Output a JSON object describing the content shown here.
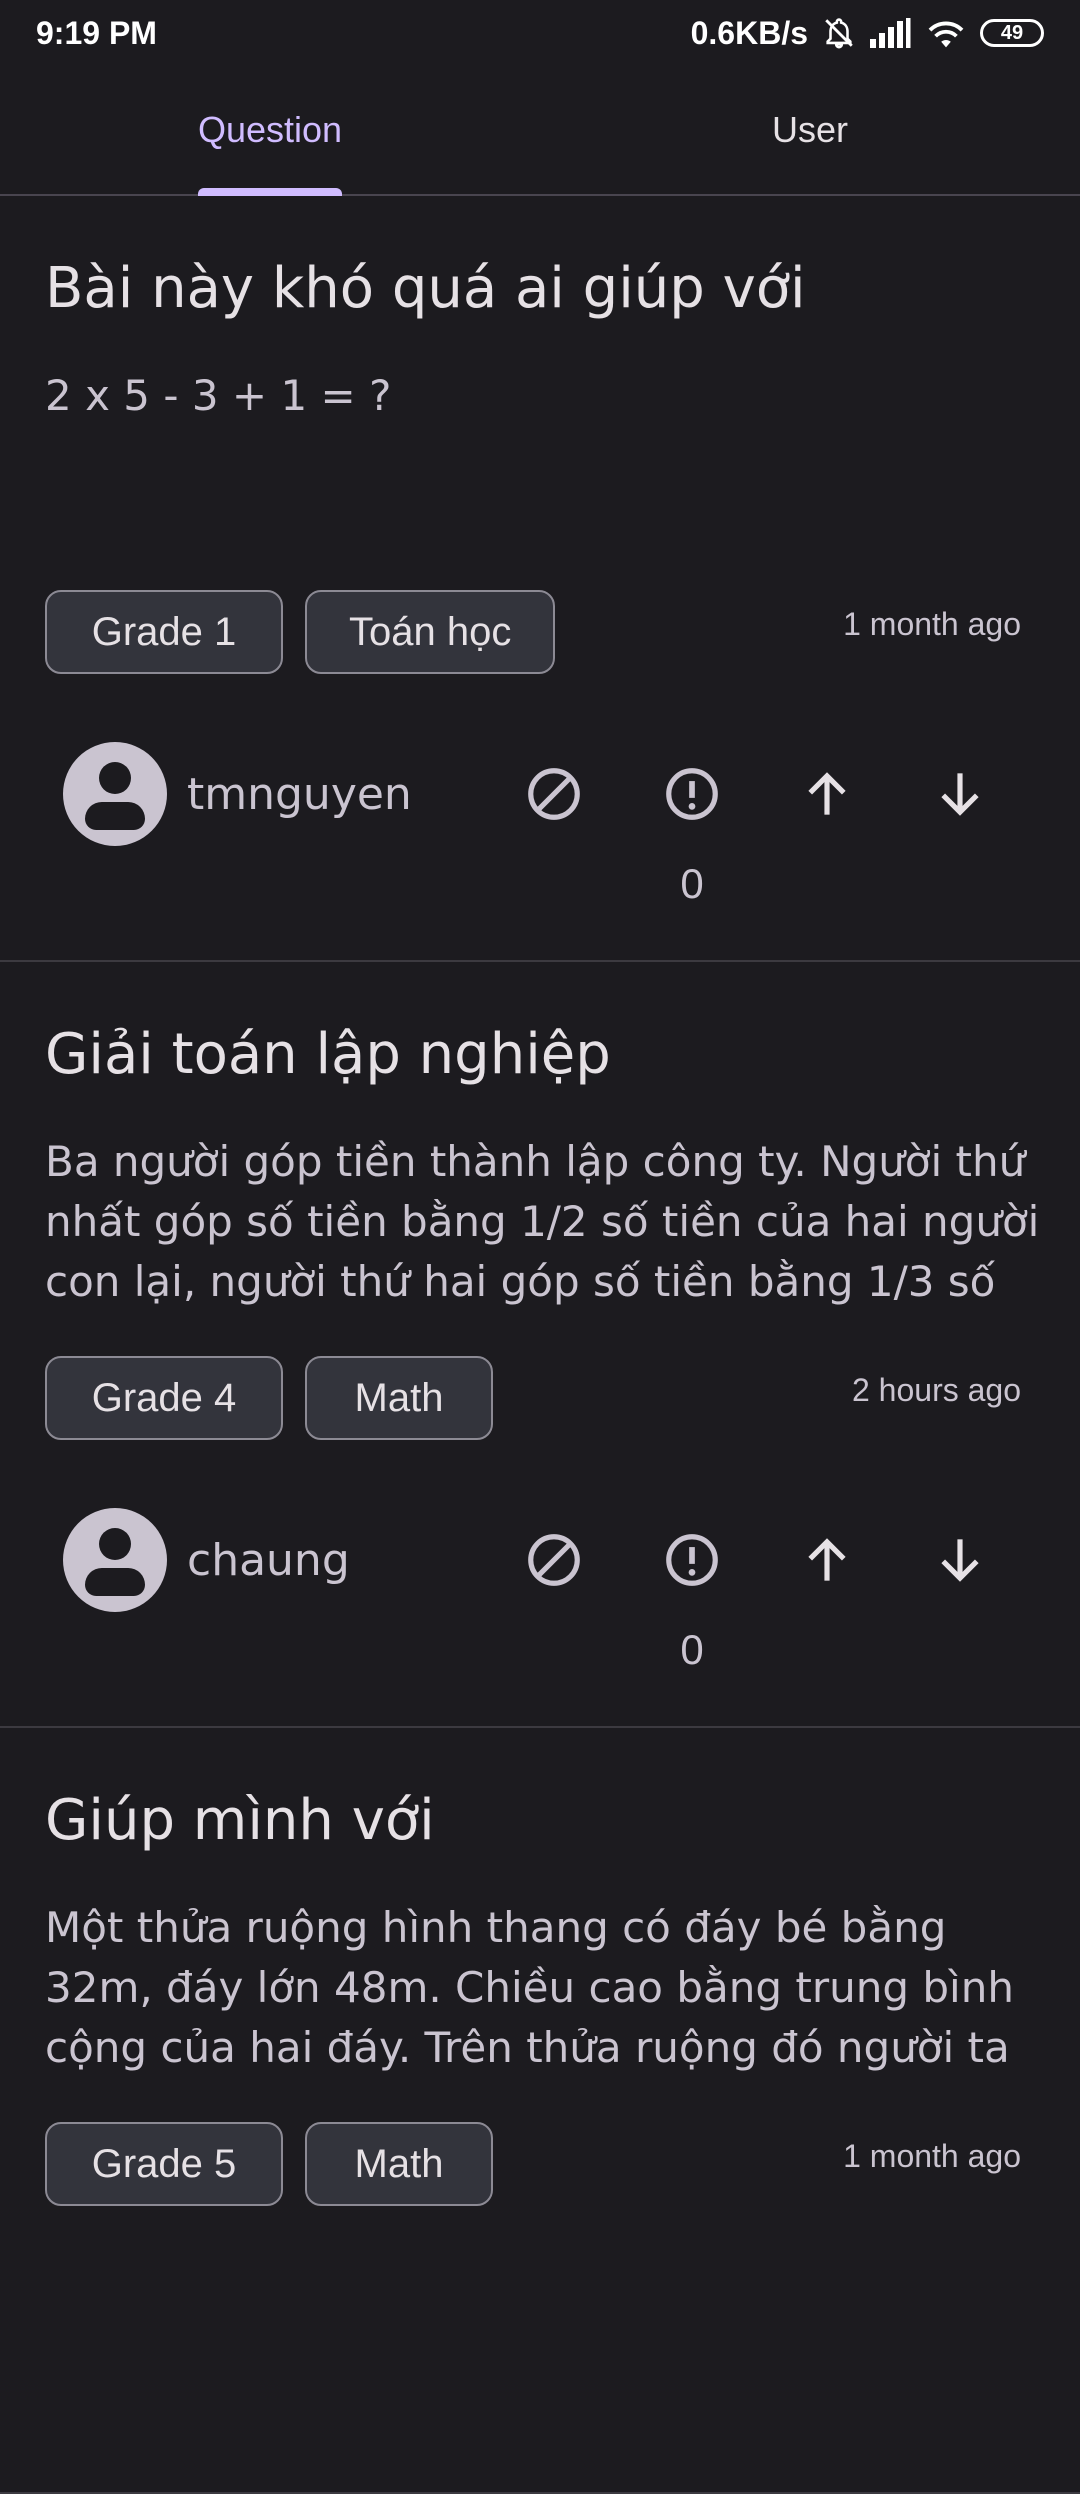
{
  "status_bar": {
    "time": "9:19 PM",
    "network_speed": "0.6KB/s",
    "battery": "49",
    "icons": [
      "bell-off-icon",
      "signal-icon",
      "wifi-icon",
      "battery-icon"
    ]
  },
  "tabs": [
    {
      "label": "Question",
      "selected": true
    },
    {
      "label": "User",
      "selected": false
    }
  ],
  "colors": {
    "accent": "#d0bcff",
    "background": "#1c1b1f",
    "chip_background": "#33343c"
  },
  "questions": [
    {
      "title": "Bài này khó quá ai giúp với",
      "body": "2 x 5 - 3 + 1 = ?",
      "tags": [
        "Grade 1",
        "Toán học"
      ],
      "time": "1 month ago",
      "author": "tmnguyen",
      "score": "0"
    },
    {
      "title": "Giải toán lập nghiệp",
      "body": "Ba người góp tiền thành lập công ty. Người thứ nhất góp số tiền bằng 1/2 số tiền của hai người con lại, người thứ hai góp số tiền bằng 1/3 số",
      "tags": [
        "Grade 4",
        "Math"
      ],
      "time": "2 hours ago",
      "author": "chaung",
      "score": "0"
    },
    {
      "title": "Giúp mình với",
      "body": "Một thửa ruộng hình thang có đáy bé bằng 32m, đáy lớn 48m. Chiều cao bằng trung bình cộng của hai đáy. Trên thửa ruộng đó người ta trồng",
      "tags": [
        "Grade 5",
        "Math"
      ],
      "time": "1 month ago",
      "author": "",
      "score": ""
    }
  ],
  "action_icons": [
    "block-icon",
    "report-icon",
    "upvote-icon",
    "downvote-icon"
  ]
}
